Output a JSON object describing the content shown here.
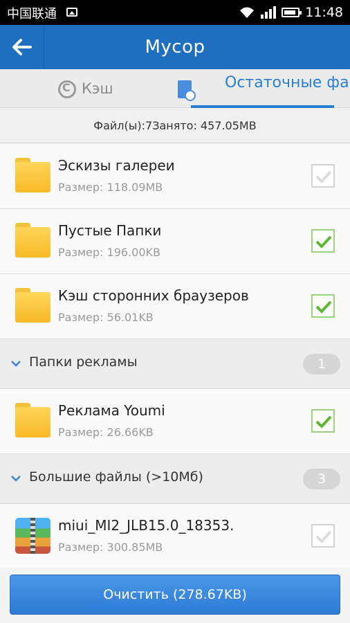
{
  "status_bar": {
    "carrier": "中国联通",
    "time": "11:48"
  },
  "header": {
    "title": "Мусор"
  },
  "tabs": [
    {
      "label": "Кэш",
      "active": false
    },
    {
      "label": "Остаточные файлы",
      "active": true
    }
  ],
  "summary": {
    "text": "Файл(ы):7Занято: 457.05MB"
  },
  "items": [
    {
      "name": "Эскизы галереи",
      "size": "Размер: 118.09MB",
      "checked": false
    },
    {
      "name": "Пустые Папки",
      "size": "Размер: 196.00KB",
      "checked": true
    },
    {
      "name": "Кэш сторонних браузеров",
      "size": "Размер: 56.01KB",
      "checked": true
    }
  ],
  "groups": [
    {
      "label": "Папки рекламы",
      "count": "1",
      "items": [
        {
          "name": "Реклама Youmi",
          "size": "Размер: 26.66KB",
          "checked": true
        }
      ]
    },
    {
      "label": "Большие файлы (>10Мб)",
      "count": "3",
      "items": [
        {
          "name": "miui_MI2_JLB15.0_18353.",
          "size": "Размер: 300.85MB",
          "checked": false
        }
      ]
    }
  ],
  "footer": {
    "clean_label": "Очистить (278.67KB)"
  },
  "colors": {
    "header": "#1f6fc0",
    "accent": "#2a7ed1",
    "check": "#5cb733",
    "button": "#3a8ce0"
  }
}
